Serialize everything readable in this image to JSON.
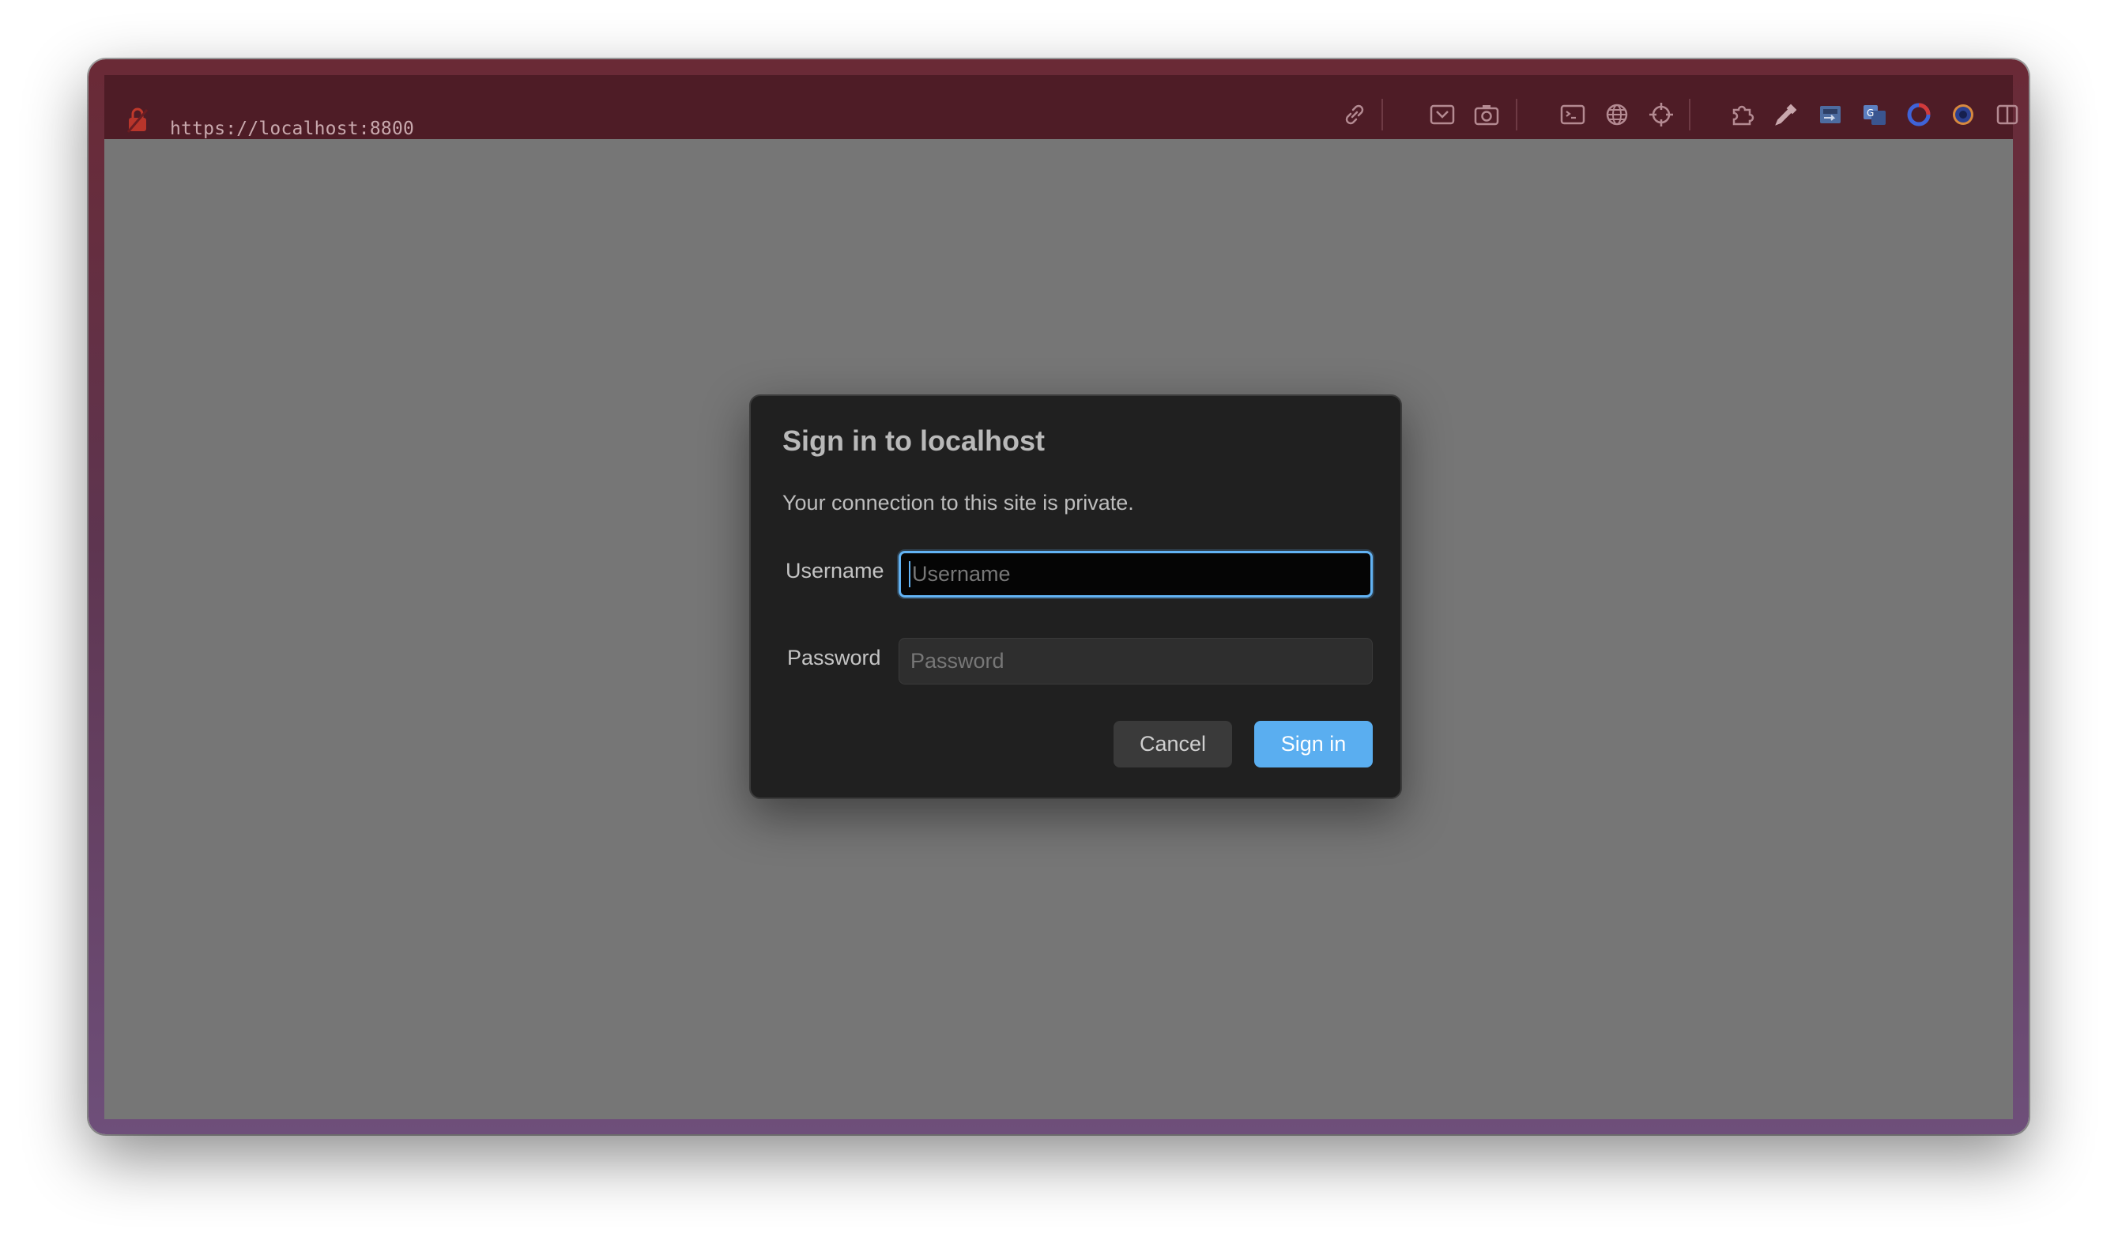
{
  "browser": {
    "url": "https://localhost:8800",
    "theme_color": "#4e1c26",
    "toolbar_icons": [
      "link-icon",
      "qr-code-icon",
      "camera-icon",
      "terminal-icon",
      "globe-icon",
      "crosshair-icon",
      "puzzle-icon",
      "eyedropper-icon",
      "extension-icon",
      "translate-icon",
      "circle-extension-icon",
      "record-icon",
      "sidebar-icon"
    ]
  },
  "dialog": {
    "title": "Sign in to localhost",
    "subtitle": "Your connection to this site is private.",
    "username_label": "Username",
    "username_placeholder": "Username",
    "username_value": "",
    "password_label": "Password",
    "password_placeholder": "Password",
    "password_value": "",
    "cancel_label": "Cancel",
    "signin_label": "Sign in",
    "accent_color": "#5aaef0"
  }
}
